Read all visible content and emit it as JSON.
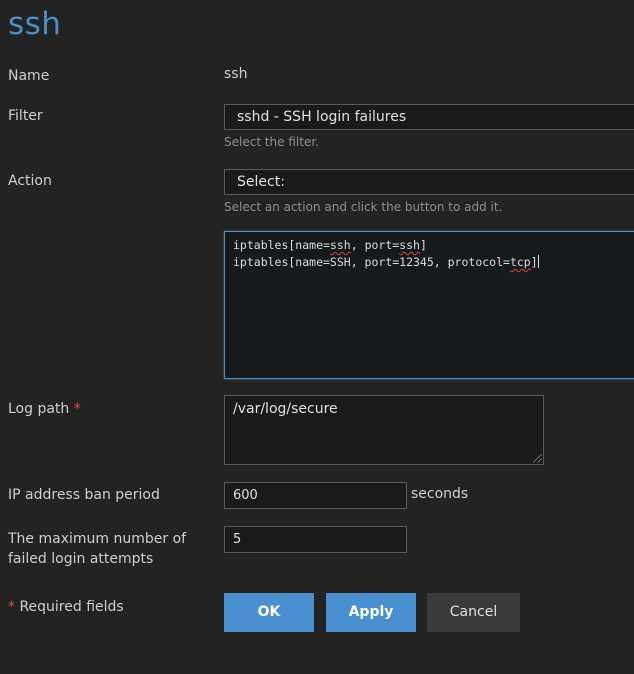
{
  "page": {
    "title": "ssh"
  },
  "form": {
    "name": {
      "label": "Name",
      "value": "ssh"
    },
    "filter": {
      "label": "Filter",
      "selected": "sshd - SSH login failures",
      "hint": "Select the filter."
    },
    "action": {
      "label": "Action",
      "selected": "Select:",
      "hint": "Select an action and click the button to add it.",
      "lines": [
        {
          "prefix": "iptables[name=",
          "word1": "ssh",
          "mid": ", port=",
          "word2": "ssh",
          "suffix": "]"
        },
        {
          "prefix": "iptables[name=SSH, port=12345, protocol=",
          "word1": "tcp",
          "suffix": "]"
        }
      ]
    },
    "log_path": {
      "label": "Log path",
      "required_mark": "*",
      "value": "/var/log/secure"
    },
    "ban_period": {
      "label": "IP address ban period",
      "value": "600",
      "unit": "seconds"
    },
    "max_attempts": {
      "label_line1": "The maximum number of",
      "label_line2": "failed login attempts",
      "value": "5"
    },
    "required_note": {
      "mark": "*",
      "text": " Required fields"
    }
  },
  "buttons": {
    "ok": "OK",
    "apply": "Apply",
    "cancel": "Cancel"
  },
  "colors": {
    "title": "#4a90c8",
    "primary_button": "#4a90d0",
    "required": "#d9534f"
  }
}
